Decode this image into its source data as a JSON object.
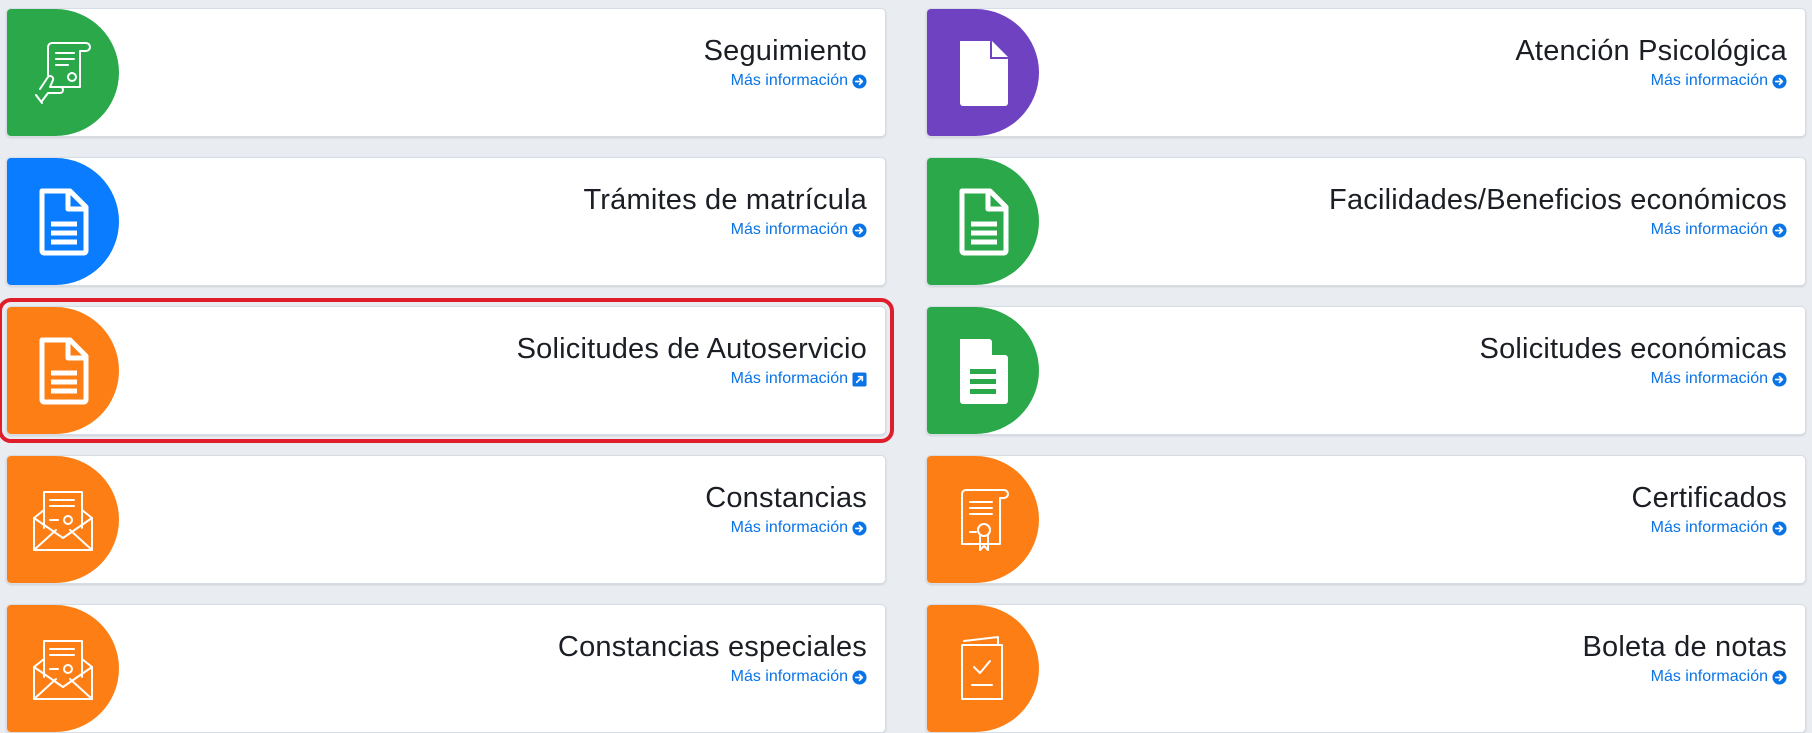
{
  "cards": [
    {
      "title": "Seguimiento",
      "link": "Más información",
      "link_icon": "arrow-circle-right-icon",
      "icon": "certificate-hand-icon",
      "color": "#2aa84a"
    },
    {
      "title": "Atención Psicológica",
      "link": "Más información",
      "link_icon": "arrow-circle-right-icon",
      "icon": "file-icon",
      "color": "#6f42c1"
    },
    {
      "title": "Trámites de matrícula",
      "link": "Más información",
      "link_icon": "arrow-circle-right-icon",
      "icon": "file-text-icon",
      "color": "#0a7cff"
    },
    {
      "title": "Facilidades/Beneficios económicos",
      "link": "Más información",
      "link_icon": "arrow-circle-right-icon",
      "icon": "file-text-icon",
      "color": "#2aa84a"
    },
    {
      "title": "Solicitudes de Autoservicio",
      "link": "Más información",
      "link_icon": "external-link-icon",
      "icon": "file-text-icon",
      "color": "#fd7e14",
      "highlighted": true
    },
    {
      "title": "Solicitudes económicas",
      "link": "Más información",
      "link_icon": "arrow-circle-right-icon",
      "icon": "file-text-solid-icon",
      "color": "#2aa84a"
    },
    {
      "title": "Constancias",
      "link": "Más información",
      "link_icon": "arrow-circle-right-icon",
      "icon": "envelope-document-icon",
      "color": "#fd7e14"
    },
    {
      "title": "Certificados",
      "link": "Más información",
      "link_icon": "arrow-circle-right-icon",
      "icon": "scroll-certificate-icon",
      "color": "#fd7e14"
    },
    {
      "title": "Constancias especiales",
      "link": "Más información",
      "link_icon": "arrow-circle-right-icon",
      "icon": "envelope-document-icon",
      "color": "#fd7e14"
    },
    {
      "title": "Boleta de notas",
      "link": "Más información",
      "link_icon": "arrow-circle-right-icon",
      "icon": "checked-document-icon",
      "color": "#fd7e14"
    }
  ]
}
